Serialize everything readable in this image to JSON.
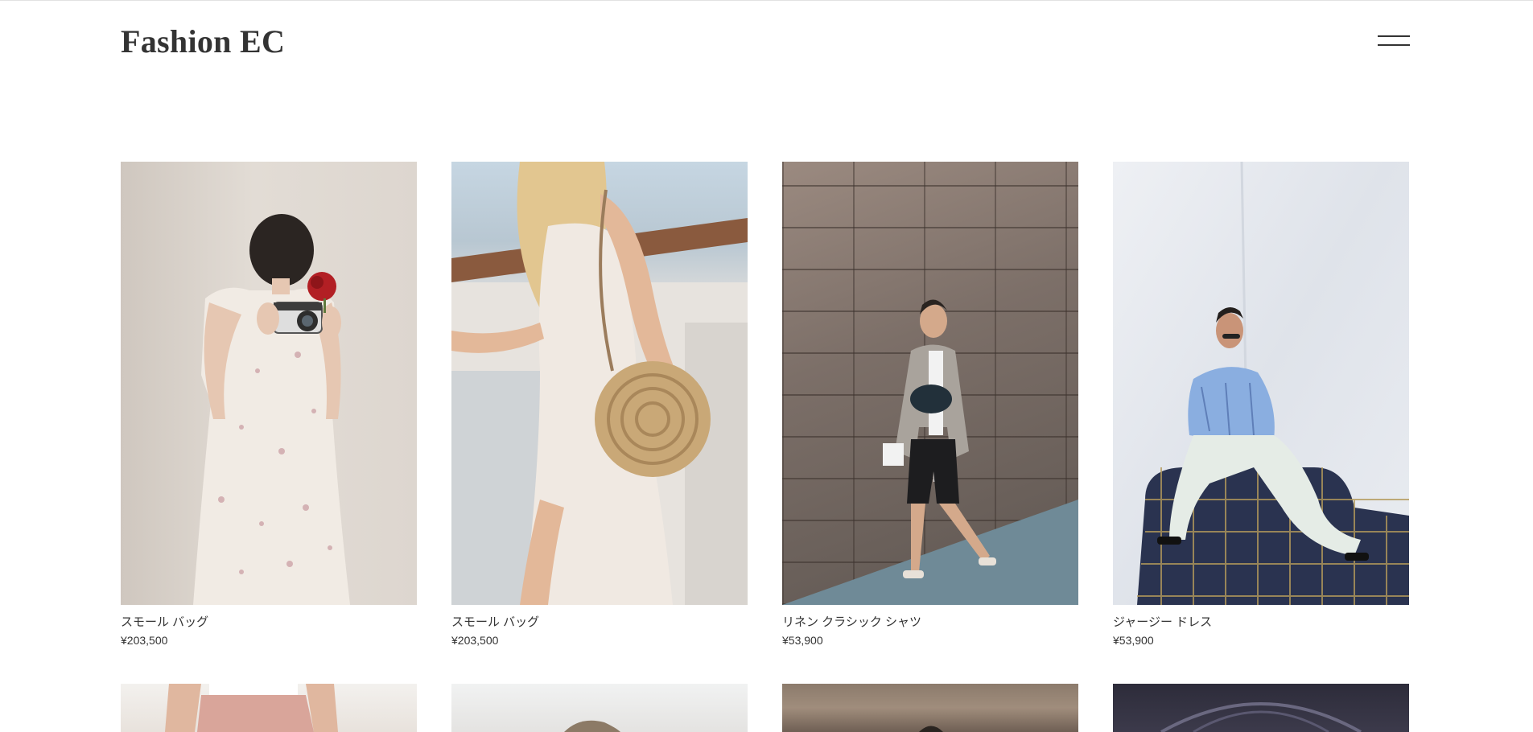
{
  "header": {
    "logo": "Fashion EC",
    "menu_icon": "hamburger-menu-icon"
  },
  "products": [
    {
      "name": "スモール バッグ",
      "price": "¥203,500",
      "image": "woman-camera-floral-dress"
    },
    {
      "name": "スモール バッグ",
      "price": "¥203,500",
      "image": "woman-white-dress-wicker-bag"
    },
    {
      "name": "リネン クラシック シャツ",
      "price": "¥53,900",
      "image": "woman-blazer-stone-wall"
    },
    {
      "name": "ジャージー ドレス",
      "price": "¥53,900",
      "image": "woman-striped-blouse-armchair"
    }
  ],
  "colors": {
    "text": "#333333",
    "background": "#ffffff"
  }
}
